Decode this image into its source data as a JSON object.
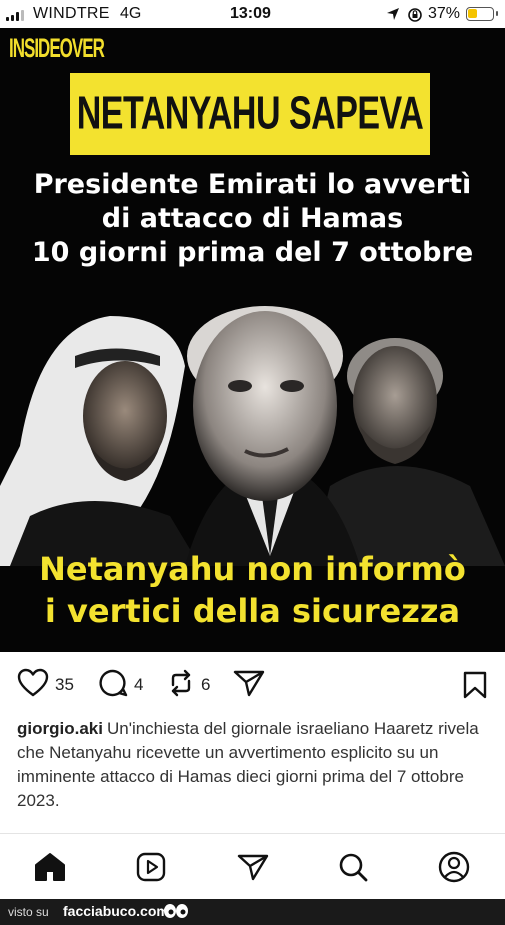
{
  "status_bar": {
    "carrier": "WINDTRE",
    "network": "4G",
    "time": "13:09",
    "battery_percent": "37%",
    "battery_level": 0.37,
    "battery_color": "#f5c400"
  },
  "post_image": {
    "logo": "INSIDEOVER",
    "headline": "NETANYAHU SAPEVA",
    "subheadline": [
      "Presidente Emirati lo avvertì",
      "di attacco di Hamas",
      "10 giorni prima del 7 ottobre"
    ],
    "bottom_text": [
      "Netanyahu non informò",
      "i vertici della sicurezza"
    ],
    "accent_color": "#f3e22f"
  },
  "actions": {
    "likes": "35",
    "comments": "4",
    "reposts": "6",
    "icons": [
      "heart-icon",
      "comment-icon",
      "repost-icon",
      "send-icon",
      "bookmark-icon"
    ]
  },
  "caption": {
    "username": "giorgio.aki",
    "text": "Un'inchiesta del giornale israeliano Haaretz rivela che Netanyahu ricevette un avvertimento esplicito su un imminente attacco di Hamas dieci giorni prima del 7 ottobre 2023."
  },
  "bottom_nav": {
    "items": [
      "home-icon",
      "reels-icon",
      "send-icon",
      "search-icon",
      "profile-icon"
    ]
  },
  "watermark": {
    "prefix": "visto su",
    "site": "facciabuco.com"
  }
}
